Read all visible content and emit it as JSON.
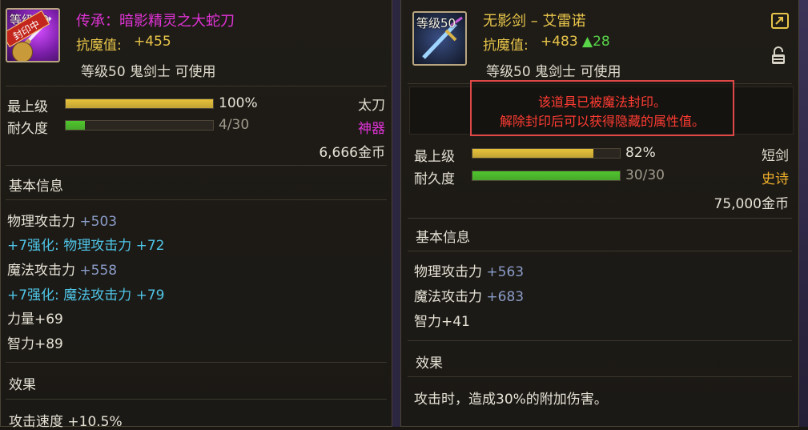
{
  "left": {
    "lvl_badge": "等级50",
    "stamp_text": "封印中",
    "title": "传承：暗影精灵之大蛇刀",
    "anti_magic_label": "抗魔值:",
    "anti_magic_value": "+455",
    "requirement": "等级50 鬼剑士 可使用",
    "stats": [
      {
        "label": "最上级",
        "value": "100%",
        "fill": 1.0,
        "color": "#e7c23a"
      },
      {
        "label": "耐久度",
        "value": "4/30",
        "fill": 0.13,
        "color": "#4fc62d"
      }
    ],
    "weapon_type": "太刀",
    "rarity": "神器",
    "price": "6,666金币",
    "section_basic": "基本信息",
    "attrs": [
      {
        "name": "物理攻击力 ",
        "val": "+503"
      },
      {
        "name": "+7强化: 物理攻击力 +72",
        "val": ""
      },
      {
        "name": "魔法攻击力 ",
        "val": "+558"
      },
      {
        "name": "+7强化: 魔法攻击力 +79",
        "val": ""
      },
      {
        "name": "力量+69",
        "val": ""
      },
      {
        "name": "智力+89",
        "val": ""
      }
    ],
    "section_effect": "效果",
    "effect_line": "攻击速度 +10.5%"
  },
  "right": {
    "lvl_badge": "等级50",
    "title": "无影剑 – 艾雷诺",
    "anti_magic_label": "抗魔值:",
    "anti_magic_value": "+483",
    "anti_magic_delta": "▲28",
    "requirement": "等级50 鬼剑士 可使用",
    "seal_line1": "该道具已被魔法封印。",
    "seal_line2": "解除封印后可以获得隐藏的属性值。",
    "stats": [
      {
        "label": "最上级",
        "value": "82%",
        "fill": 0.82,
        "color": "#e7c23a"
      },
      {
        "label": "耐久度",
        "value": "30/30",
        "fill": 1.0,
        "color": "#4fc62d"
      }
    ],
    "weapon_type": "短剑",
    "rarity": "史诗",
    "price": "75,000金币",
    "section_basic": "基本信息",
    "attrs": [
      {
        "name": "物理攻击力 ",
        "val": "+563"
      },
      {
        "name": "魔法攻击力 ",
        "val": "+683"
      },
      {
        "name": "智力+41",
        "val": ""
      }
    ],
    "section_effect": "效果",
    "effect_line": "攻击时，造成30%的附加伤害。"
  },
  "colors": {
    "title_magenta": "#e033d6",
    "title_gold": "#e8c54a",
    "enhance_cyan": "#4fc6e8",
    "attr_blue": "#8a9cc8",
    "seal_red": "#ff3b33",
    "rarity_epic": "#f0b02a"
  },
  "icons": [
    "sword-item-icon",
    "blade-item-icon",
    "sealed-stamp-icon",
    "compare-icon",
    "lock-icon"
  ]
}
